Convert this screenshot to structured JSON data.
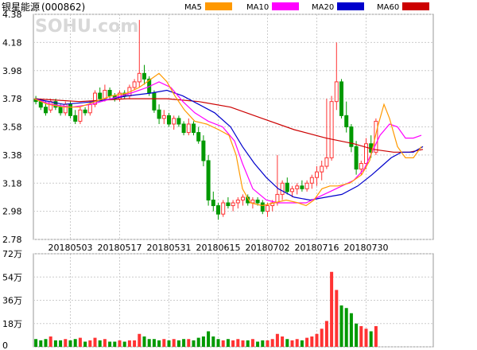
{
  "stock": {
    "title": "银星能源",
    "code": "(000862)"
  },
  "watermark": "SOHU.com",
  "colors": {
    "up": "#ff3333",
    "down": "#009900",
    "grid": "#cccccc",
    "ma5": "#ff9900",
    "ma10": "#ff00ff",
    "ma20": "#0000cc",
    "ma60": "#cc0000"
  },
  "legend": [
    {
      "key": "ma5",
      "label": "MA5"
    },
    {
      "key": "ma10",
      "label": "MA10"
    },
    {
      "key": "ma20",
      "label": "MA20"
    },
    {
      "key": "ma60",
      "label": "MA60"
    }
  ],
  "price_axis": {
    "ticks": [
      "4.38",
      "4.18",
      "3.98",
      "3.78",
      "3.58",
      "3.38",
      "3.18",
      "2.98",
      "2.78"
    ],
    "ylim": [
      2.78,
      4.38
    ]
  },
  "volume_axis": {
    "ticks": [
      "72万",
      "54万",
      "36万",
      "18万",
      "0"
    ],
    "ylim": [
      0,
      72
    ]
  },
  "date_labels": [
    "20180503",
    "20180517",
    "20180531",
    "20180615",
    "20180702",
    "20180716",
    "20180730"
  ],
  "chart_data": {
    "type": "candlestick",
    "x_start": 42,
    "slot": 6.2,
    "date_label_slots": [
      7,
      17,
      27,
      37,
      47,
      57,
      67
    ],
    "ohlc": [
      [
        3.78,
        3.8,
        3.74,
        3.76
      ],
      [
        3.76,
        3.78,
        3.7,
        3.72
      ],
      [
        3.72,
        3.76,
        3.66,
        3.68
      ],
      [
        3.7,
        3.78,
        3.68,
        3.76
      ],
      [
        3.76,
        3.78,
        3.7,
        3.72
      ],
      [
        3.72,
        3.74,
        3.66,
        3.68
      ],
      [
        3.68,
        3.76,
        3.66,
        3.74
      ],
      [
        3.74,
        3.76,
        3.64,
        3.66
      ],
      [
        3.66,
        3.7,
        3.6,
        3.62
      ],
      [
        3.62,
        3.72,
        3.6,
        3.7
      ],
      [
        3.7,
        3.72,
        3.66,
        3.68
      ],
      [
        3.68,
        3.76,
        3.66,
        3.74
      ],
      [
        3.74,
        3.84,
        3.72,
        3.82
      ],
      [
        3.82,
        3.86,
        3.76,
        3.78
      ],
      [
        3.78,
        3.88,
        3.76,
        3.84
      ],
      [
        3.84,
        3.86,
        3.78,
        3.8
      ],
      [
        3.8,
        3.82,
        3.76,
        3.78
      ],
      [
        3.78,
        3.84,
        3.76,
        3.82
      ],
      [
        3.82,
        3.84,
        3.78,
        3.8
      ],
      [
        3.8,
        3.88,
        3.78,
        3.86
      ],
      [
        3.86,
        3.92,
        3.84,
        3.9
      ],
      [
        3.9,
        4.34,
        3.86,
        3.96
      ],
      [
        3.96,
        4.02,
        3.88,
        3.92
      ],
      [
        3.92,
        3.94,
        3.8,
        3.82
      ],
      [
        3.82,
        3.84,
        3.68,
        3.7
      ],
      [
        3.7,
        3.74,
        3.6,
        3.64
      ],
      [
        3.64,
        3.7,
        3.6,
        3.66
      ],
      [
        3.66,
        3.68,
        3.58,
        3.6
      ],
      [
        3.6,
        3.66,
        3.56,
        3.64
      ],
      [
        3.64,
        3.66,
        3.58,
        3.6
      ],
      [
        3.6,
        3.62,
        3.52,
        3.54
      ],
      [
        3.54,
        3.64,
        3.52,
        3.6
      ],
      [
        3.6,
        3.62,
        3.52,
        3.54
      ],
      [
        3.54,
        3.58,
        3.46,
        3.48
      ],
      [
        3.48,
        3.52,
        3.3,
        3.34
      ],
      [
        3.34,
        3.38,
        3.02,
        3.06
      ],
      [
        3.06,
        3.12,
        2.98,
        3.02
      ],
      [
        3.02,
        3.04,
        2.92,
        2.96
      ],
      [
        2.96,
        3.06,
        2.94,
        3.04
      ],
      [
        3.04,
        3.08,
        3.0,
        3.02
      ],
      [
        3.02,
        3.06,
        2.98,
        3.04
      ],
      [
        3.04,
        3.08,
        3.0,
        3.06
      ],
      [
        3.06,
        3.1,
        3.02,
        3.08
      ],
      [
        3.08,
        3.1,
        3.02,
        3.04
      ],
      [
        3.04,
        3.08,
        3.0,
        3.06
      ],
      [
        3.06,
        3.08,
        3.02,
        3.04
      ],
      [
        3.04,
        3.06,
        2.96,
        2.98
      ],
      [
        2.98,
        3.04,
        2.94,
        3.02
      ],
      [
        3.02,
        3.06,
        2.98,
        3.04
      ],
      [
        3.04,
        3.38,
        3.02,
        3.1
      ],
      [
        3.1,
        3.2,
        3.06,
        3.18
      ],
      [
        3.18,
        3.22,
        3.1,
        3.12
      ],
      [
        3.12,
        3.16,
        3.08,
        3.14
      ],
      [
        3.14,
        3.18,
        3.1,
        3.16
      ],
      [
        3.16,
        3.2,
        3.12,
        3.14
      ],
      [
        3.14,
        3.2,
        3.12,
        3.18
      ],
      [
        3.18,
        3.24,
        3.14,
        3.22
      ],
      [
        3.22,
        3.3,
        3.16,
        3.26
      ],
      [
        3.26,
        3.34,
        3.2,
        3.3
      ],
      [
        3.3,
        3.78,
        3.28,
        3.36
      ],
      [
        3.36,
        3.8,
        3.34,
        3.76
      ],
      [
        3.76,
        4.18,
        3.7,
        3.9
      ],
      [
        3.9,
        3.92,
        3.64,
        3.66
      ],
      [
        3.66,
        3.76,
        3.54,
        3.58
      ],
      [
        3.58,
        3.6,
        3.4,
        3.44
      ],
      [
        3.44,
        3.48,
        3.24,
        3.28
      ],
      [
        3.28,
        3.34,
        3.24,
        3.32
      ],
      [
        3.32,
        3.5,
        3.28,
        3.46
      ],
      [
        3.46,
        3.52,
        3.36,
        3.4
      ],
      [
        3.4,
        3.64,
        3.38,
        3.62
      ]
    ],
    "volume": [
      6,
      5,
      6,
      8,
      5,
      5,
      6,
      5,
      6,
      7,
      4,
      5,
      7,
      5,
      6,
      4,
      4,
      5,
      4,
      5,
      5,
      10,
      8,
      6,
      6,
      5,
      6,
      5,
      6,
      5,
      6,
      6,
      5,
      7,
      8,
      12,
      8,
      6,
      5,
      6,
      5,
      6,
      5,
      5,
      6,
      4,
      5,
      5,
      6,
      10,
      8,
      6,
      5,
      6,
      5,
      7,
      8,
      10,
      14,
      20,
      58,
      44,
      32,
      30,
      26,
      18,
      16,
      14,
      12,
      16
    ],
    "ma5": [
      [
        43,
        3.78
      ],
      [
        60,
        3.74
      ],
      [
        80,
        3.72
      ],
      [
        100,
        3.72
      ],
      [
        120,
        3.76
      ],
      [
        140,
        3.8
      ],
      [
        160,
        3.82
      ],
      [
        175,
        3.86
      ],
      [
        190,
        3.92
      ],
      [
        200,
        3.96
      ],
      [
        210,
        3.9
      ],
      [
        220,
        3.8
      ],
      [
        232,
        3.7
      ],
      [
        245,
        3.62
      ],
      [
        260,
        3.6
      ],
      [
        275,
        3.56
      ],
      [
        288,
        3.52
      ],
      [
        297,
        3.38
      ],
      [
        305,
        3.14
      ],
      [
        315,
        3.04
      ],
      [
        330,
        3.02
      ],
      [
        345,
        3.04
      ],
      [
        360,
        3.06
      ],
      [
        375,
        3.04
      ],
      [
        385,
        3.02
      ],
      [
        395,
        3.06
      ],
      [
        405,
        3.14
      ],
      [
        415,
        3.16
      ],
      [
        425,
        3.16
      ],
      [
        440,
        3.18
      ],
      [
        455,
        3.24
      ],
      [
        465,
        3.34
      ],
      [
        475,
        3.58
      ],
      [
        483,
        3.74
      ],
      [
        490,
        3.64
      ],
      [
        500,
        3.44
      ],
      [
        510,
        3.36
      ],
      [
        520,
        3.36
      ],
      [
        530,
        3.44
      ]
    ],
    "ma10": [
      [
        43,
        3.78
      ],
      [
        65,
        3.74
      ],
      [
        90,
        3.72
      ],
      [
        115,
        3.74
      ],
      [
        140,
        3.78
      ],
      [
        165,
        3.82
      ],
      [
        185,
        3.86
      ],
      [
        200,
        3.9
      ],
      [
        215,
        3.86
      ],
      [
        230,
        3.76
      ],
      [
        245,
        3.68
      ],
      [
        262,
        3.62
      ],
      [
        280,
        3.58
      ],
      [
        295,
        3.48
      ],
      [
        305,
        3.32
      ],
      [
        318,
        3.14
      ],
      [
        335,
        3.06
      ],
      [
        350,
        3.04
      ],
      [
        370,
        3.04
      ],
      [
        385,
        3.04
      ],
      [
        400,
        3.08
      ],
      [
        415,
        3.12
      ],
      [
        430,
        3.16
      ],
      [
        445,
        3.2
      ],
      [
        458,
        3.28
      ],
      [
        468,
        3.4
      ],
      [
        478,
        3.52
      ],
      [
        490,
        3.6
      ],
      [
        500,
        3.58
      ],
      [
        510,
        3.5
      ],
      [
        520,
        3.5
      ],
      [
        530,
        3.52
      ]
    ],
    "ma20": [
      [
        43,
        3.78
      ],
      [
        80,
        3.74
      ],
      [
        120,
        3.76
      ],
      [
        160,
        3.8
      ],
      [
        190,
        3.82
      ],
      [
        210,
        3.84
      ],
      [
        230,
        3.8
      ],
      [
        250,
        3.74
      ],
      [
        270,
        3.68
      ],
      [
        290,
        3.58
      ],
      [
        305,
        3.44
      ],
      [
        320,
        3.32
      ],
      [
        335,
        3.22
      ],
      [
        350,
        3.14
      ],
      [
        370,
        3.08
      ],
      [
        390,
        3.06
      ],
      [
        410,
        3.08
      ],
      [
        430,
        3.1
      ],
      [
        450,
        3.16
      ],
      [
        468,
        3.24
      ],
      [
        480,
        3.3
      ],
      [
        492,
        3.36
      ],
      [
        505,
        3.4
      ],
      [
        520,
        3.4
      ],
      [
        532,
        3.44
      ]
    ],
    "ma60": [
      [
        43,
        3.78
      ],
      [
        100,
        3.76
      ],
      [
        160,
        3.78
      ],
      [
        210,
        3.78
      ],
      [
        250,
        3.76
      ],
      [
        290,
        3.72
      ],
      [
        330,
        3.64
      ],
      [
        370,
        3.56
      ],
      [
        410,
        3.5
      ],
      [
        445,
        3.46
      ],
      [
        470,
        3.42
      ],
      [
        495,
        3.4
      ],
      [
        515,
        3.4
      ],
      [
        532,
        3.42
      ]
    ]
  }
}
